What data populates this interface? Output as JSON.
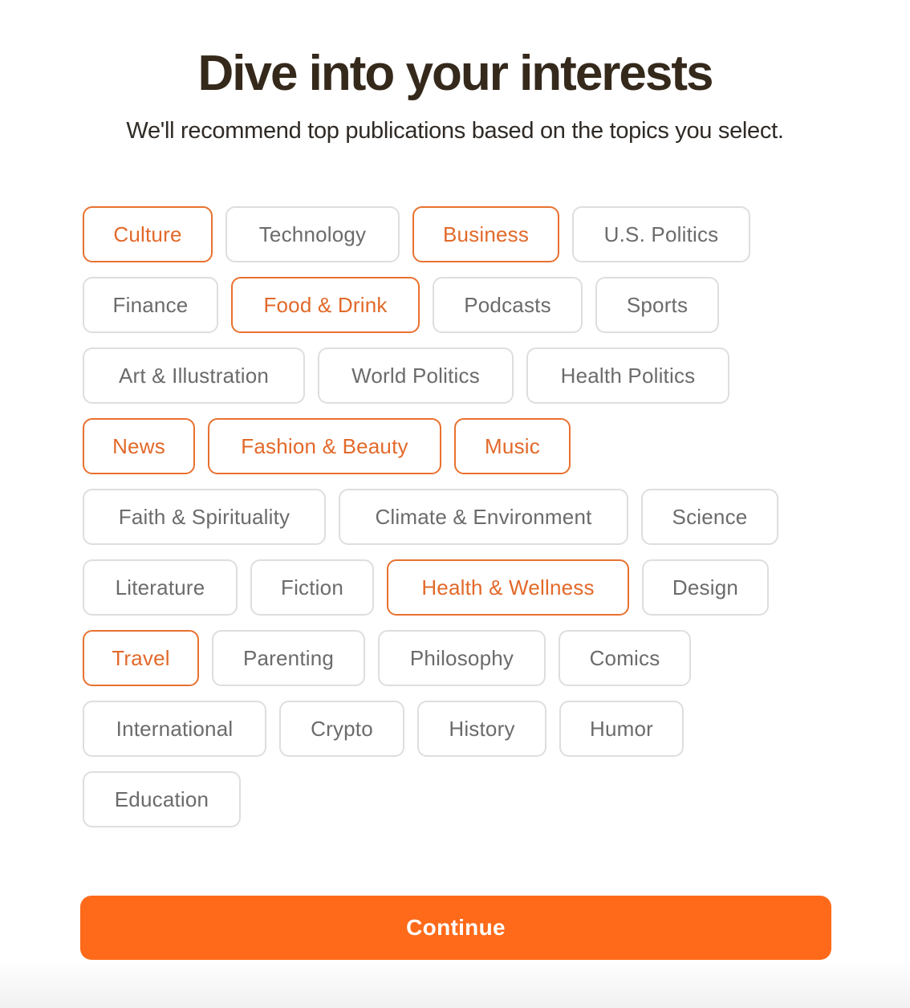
{
  "header": {
    "title": "Dive into your interests",
    "subtitle": "We'll recommend top publications based on the topics you select."
  },
  "colors": {
    "accent": "#fe6a1a",
    "selected_border": "#e8712f",
    "selected_text": "#e2692a",
    "unselected_border": "#dedede",
    "unselected_text": "#6b6b6b",
    "title_text": "#35291c"
  },
  "topics": [
    {
      "label": "Culture",
      "selected": true
    },
    {
      "label": "Technology",
      "selected": false
    },
    {
      "label": "Business",
      "selected": true
    },
    {
      "label": "U.S. Politics",
      "selected": false
    },
    {
      "label": "Finance",
      "selected": false
    },
    {
      "label": "Food & Drink",
      "selected": true
    },
    {
      "label": "Podcasts",
      "selected": false
    },
    {
      "label": "Sports",
      "selected": false
    },
    {
      "label": "Art & Illustration",
      "selected": false
    },
    {
      "label": "World Politics",
      "selected": false
    },
    {
      "label": "Health Politics",
      "selected": false
    },
    {
      "label": "News",
      "selected": true
    },
    {
      "label": "Fashion & Beauty",
      "selected": true
    },
    {
      "label": "Music",
      "selected": true
    },
    {
      "label": "Faith & Spirituality",
      "selected": false
    },
    {
      "label": "Climate & Environment",
      "selected": false
    },
    {
      "label": "Science",
      "selected": false
    },
    {
      "label": "Literature",
      "selected": false
    },
    {
      "label": "Fiction",
      "selected": false
    },
    {
      "label": "Health & Wellness",
      "selected": true
    },
    {
      "label": "Design",
      "selected": false
    },
    {
      "label": "Travel",
      "selected": true
    },
    {
      "label": "Parenting",
      "selected": false
    },
    {
      "label": "Philosophy",
      "selected": false
    },
    {
      "label": "Comics",
      "selected": false
    },
    {
      "label": "International",
      "selected": false
    },
    {
      "label": "Crypto",
      "selected": false
    },
    {
      "label": "History",
      "selected": false
    },
    {
      "label": "Humor",
      "selected": false
    },
    {
      "label": "Education",
      "selected": false
    }
  ],
  "footer": {
    "continue_label": "Continue"
  }
}
